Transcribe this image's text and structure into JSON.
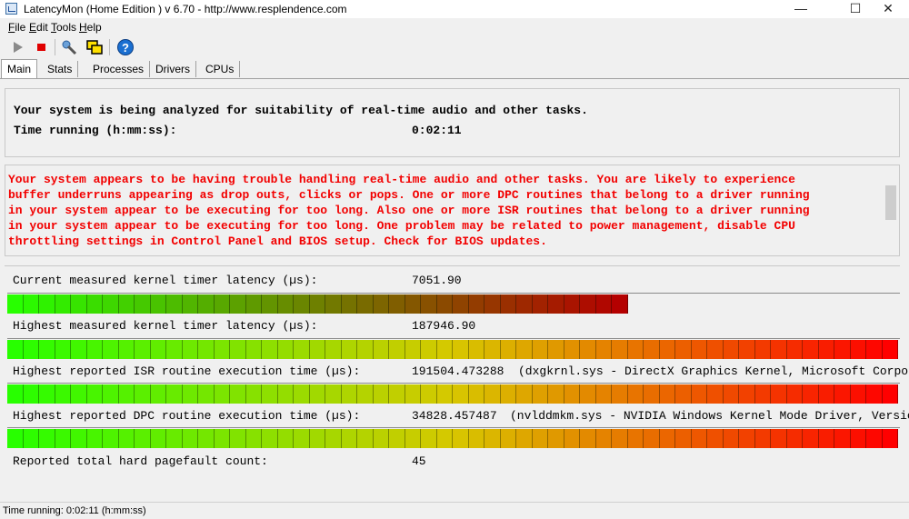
{
  "window": {
    "title": "LatencyMon  (Home Edition )  v 6.70 - http://www.resplendence.com",
    "minimize": "—",
    "maximize": "☐",
    "close": "✕"
  },
  "menu": [
    {
      "label": "File",
      "mnemonic": "F",
      "rest": "ile"
    },
    {
      "label": "Edit",
      "mnemonic": "E",
      "rest": "dit"
    },
    {
      "label": "Tools",
      "mnemonic": "T",
      "rest": "ools"
    },
    {
      "label": "Help",
      "mnemonic": "H",
      "rest": "elp"
    }
  ],
  "toolbar": {
    "icons": [
      "play-icon",
      "stop-icon",
      "options-icon",
      "windows-icon",
      "help-icon"
    ],
    "colors": {
      "play": "#8a8a8a",
      "stop": "#e00000",
      "help": "#1a6fd1"
    }
  },
  "tabs": [
    {
      "label": "Main",
      "active": true
    },
    {
      "label": "Stats",
      "active": false
    },
    {
      "label": "Processes",
      "active": false
    },
    {
      "label": "Drivers",
      "active": false
    },
    {
      "label": "CPUs",
      "active": false
    }
  ],
  "main": {
    "analysis_text": "Your system is being analyzed for suitability of real-time audio and other tasks.",
    "time_running_label": "Time running (h:mm:ss):",
    "time_running_value": "0:02:11",
    "warning_lines": [
      "Your system appears to be having trouble handling real-time audio and other tasks. You are likely to experience",
      "buffer underruns appearing as drop outs, clicks or pops. One or more DPC routines that belong to a driver running",
      "in your system appear to be executing for too long. Also one or more ISR routines that belong to a driver running",
      "in your system appear to be executing for too long. One problem may be related to power management, disable CPU",
      "throttling settings in Control Panel and BIOS setup. Check for BIOS updates."
    ],
    "warning_color": "#f20000",
    "metrics": [
      {
        "label": "Current measured kernel timer latency (µs):",
        "value": "7051.90",
        "detail": "",
        "bar_fraction": 0.7
      },
      {
        "label": "Highest measured kernel timer latency (µs):",
        "value": "187946.90",
        "detail": "",
        "bar_fraction": 1.0
      },
      {
        "label": "Highest reported ISR routine execution time (µs):",
        "value": "191504.473288",
        "detail": "(dxgkrnl.sys - DirectX Graphics Kernel, Microsoft Corpor",
        "bar_fraction": 1.0
      },
      {
        "label": "Highest reported DPC routine execution time (µs):",
        "value": "34828.457487",
        "detail": "(nvlddmkm.sys - NVIDIA Windows Kernel Mode Driver, Versio",
        "bar_fraction": 1.0
      }
    ],
    "pagefault_label": "Reported total hard pagefault count:",
    "pagefault_value": "45"
  },
  "status": {
    "text": "Time running: 0:02:11  (h:mm:ss)"
  }
}
